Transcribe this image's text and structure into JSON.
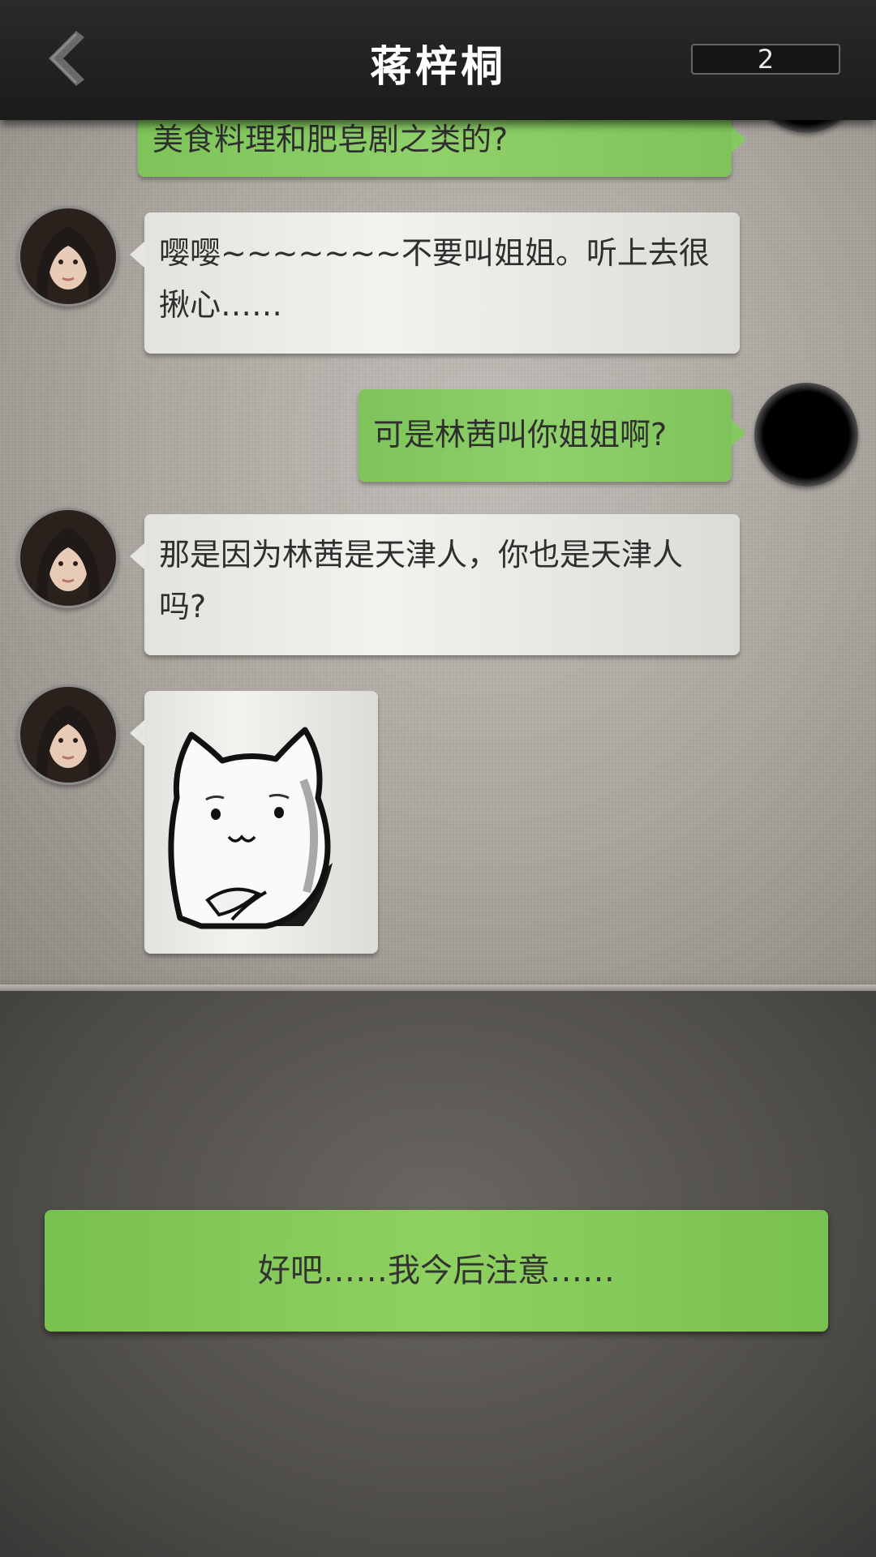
{
  "header": {
    "title": "蒋梓桐",
    "counter": "2"
  },
  "messages": [
    {
      "side": "right",
      "text": "美食料理和肥皂剧之类的?"
    },
    {
      "side": "left",
      "text": "嘤嘤~~~~~~~不要叫姐姐。听上去很揪心……"
    },
    {
      "side": "right",
      "text": "可是林茜叫你姐姐啊?"
    },
    {
      "side": "left",
      "text": "那是因为林茜是天津人，你也是天津人吗?"
    },
    {
      "side": "left",
      "type": "sticker",
      "sticker": "cat-sticker"
    }
  ],
  "choices": [
    {
      "label": "好吧……我今后注意……"
    }
  ]
}
